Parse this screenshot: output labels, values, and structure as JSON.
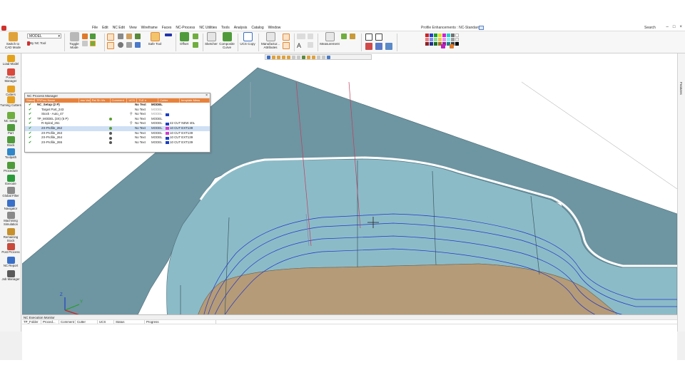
{
  "menubar": {
    "items": [
      "File",
      "Edit",
      "NC Edit",
      "View",
      "Wireframe",
      "Faces",
      "NC-Process",
      "NC Utilities",
      "Tools",
      "Analysis",
      "Catalog",
      "Window"
    ],
    "window_title": "Profile Enhancements : NC-Standard",
    "search_label": "Search",
    "win_controls": [
      "–",
      "□",
      "×"
    ]
  },
  "ribbon": {
    "model_select": "MODEL",
    "by_nc_tool": "By NC Tool",
    "switch_cad_mode": "Switch to\nCAD Mode",
    "toggle_mode": "Toggle\nMode",
    "safe_tool": "Safe Tool",
    "offset": "Offset",
    "sketcher": "Sketcher",
    "composite_curve": "Composite\nCurve",
    "ucs_copy": "UCS Copy",
    "manufacturing_attributes": "Manufactur...\nAttributes",
    "measurement": "Measurement"
  },
  "left_toolbar": [
    {
      "label": "Load Model",
      "icon": "load-model-icon",
      "color": "#e4a21b"
    },
    {
      "label": "Pocket Manager",
      "icon": "pocket-manager-icon",
      "color": "#d9483b"
    },
    {
      "label": "Cutters",
      "icon": "cutters-icon",
      "color": "#e6a020"
    },
    {
      "label": "Turning Cutters",
      "icon": "turning-cutters-icon",
      "color": "#e6a020"
    },
    {
      "label": "NC Setup",
      "icon": "nc-setup-icon",
      "color": "#6fae3f"
    },
    {
      "label": "Part",
      "icon": "part-icon",
      "color": "#4f9b3b"
    },
    {
      "label": "Stock",
      "icon": "stock-icon",
      "color": "#4f9b3b"
    },
    {
      "label": "Toolpath",
      "icon": "toolpath-icon",
      "color": "#2f86c8"
    },
    {
      "label": "Procedure",
      "icon": "procedure-icon",
      "color": "#4f9b3b"
    },
    {
      "label": "Execute",
      "icon": "execute-icon",
      "color": "#2b9a3a"
    },
    {
      "label": "Global Filter",
      "icon": "global-filter-icon",
      "color": "#8a8a8a"
    },
    {
      "label": "Navigator",
      "icon": "navigator-icon",
      "color": "#3a6fc8"
    },
    {
      "label": "Machining Simulation",
      "icon": "machining-simulation-icon",
      "color": "#8a8a8a"
    },
    {
      "label": "Remaining Stock",
      "icon": "remaining-stock-icon",
      "color": "#c8902a"
    },
    {
      "label": "Post Process",
      "icon": "post-process-icon",
      "color": "#c84a3a"
    },
    {
      "label": "NC Report",
      "icon": "nc-report-icon",
      "color": "#3a6fc8"
    },
    {
      "label": "Job Manager",
      "icon": "job-manager-icon",
      "color": "#5a5a5a"
    }
  ],
  "right_strip": {
    "features_tab": "Features"
  },
  "nc_process_manager": {
    "title": "NC Process Manager",
    "columns": [
      "Status",
      "TP/Proc Name",
      "ess Var I",
      "Pat Sh Vis",
      "Comment",
      "UCS",
      "TLE n",
      "Cutter",
      "template Mess"
    ],
    "rows": [
      {
        "indent": 0,
        "name": "NC_Setup (2 P)",
        "comment": "No Text",
        "ucs": "MODEL",
        "cutter": "",
        "swatch": "",
        "bold": true
      },
      {
        "indent": 1,
        "name": "Target Part_243",
        "comment": "No Text",
        "ucs": "MODEL",
        "cutter": "",
        "swatch": "",
        "dim": true
      },
      {
        "indent": 1,
        "name": "Stock - Auto_47",
        "comment": "No Text",
        "ucs": "MODEL",
        "cutter": "",
        "swatch": "#1b3fc4",
        "tool": true
      },
      {
        "indent": 1,
        "name": "TP_MODEL (3X) (5 P)",
        "comment": "No Text",
        "ucs": "MODEL",
        "cutter": "",
        "swatch": "",
        "pin": "#5aa02c"
      },
      {
        "indent": 2,
        "name": "R-Spiral_261",
        "comment": "No Text",
        "ucs": "MODEL",
        "cutter": "42 CUT NEW 40L",
        "swatch": "#1b3fc4",
        "tool": true
      },
      {
        "indent": 2,
        "name": "2X-Profile_262",
        "comment": "No Text",
        "ucs": "MODEL",
        "cutter": "10 CUT EXT139",
        "swatch": "#d03bd0",
        "pin": "#5aa02c",
        "sel": true
      },
      {
        "indent": 2,
        "name": "2X-Profile_263",
        "comment": "No Text",
        "ucs": "MODEL",
        "cutter": "10 CUT EXT139",
        "swatch": "#d03bd0",
        "pin": "#555555"
      },
      {
        "indent": 2,
        "name": "2X-Profile_264",
        "comment": "No Text",
        "ucs": "MODEL",
        "cutter": "10 CUT EXT139",
        "swatch": "#1b3fc4",
        "pin": "#555555"
      },
      {
        "indent": 2,
        "name": "2X-Profile_265",
        "comment": "No Text",
        "ucs": "MODEL",
        "cutter": "10 CUT EXT139",
        "swatch": "#1b3fc4",
        "pin": "#555555"
      }
    ]
  },
  "triad": {
    "x": "X",
    "y": "Y",
    "z": "Z"
  },
  "nc_execution_monitor": {
    "title": "NC Execution Monitor",
    "columns": [
      "TP_Folder",
      "Proced...",
      "Comment",
      "Cutter",
      "UCS",
      "Status",
      "Progress"
    ]
  },
  "colors": {
    "accent_orange": "#e8813a",
    "part_top": "#6f96a2",
    "wall": "#8cbbc8",
    "floor": "#b59b77",
    "toolpath": "#2238c8"
  }
}
